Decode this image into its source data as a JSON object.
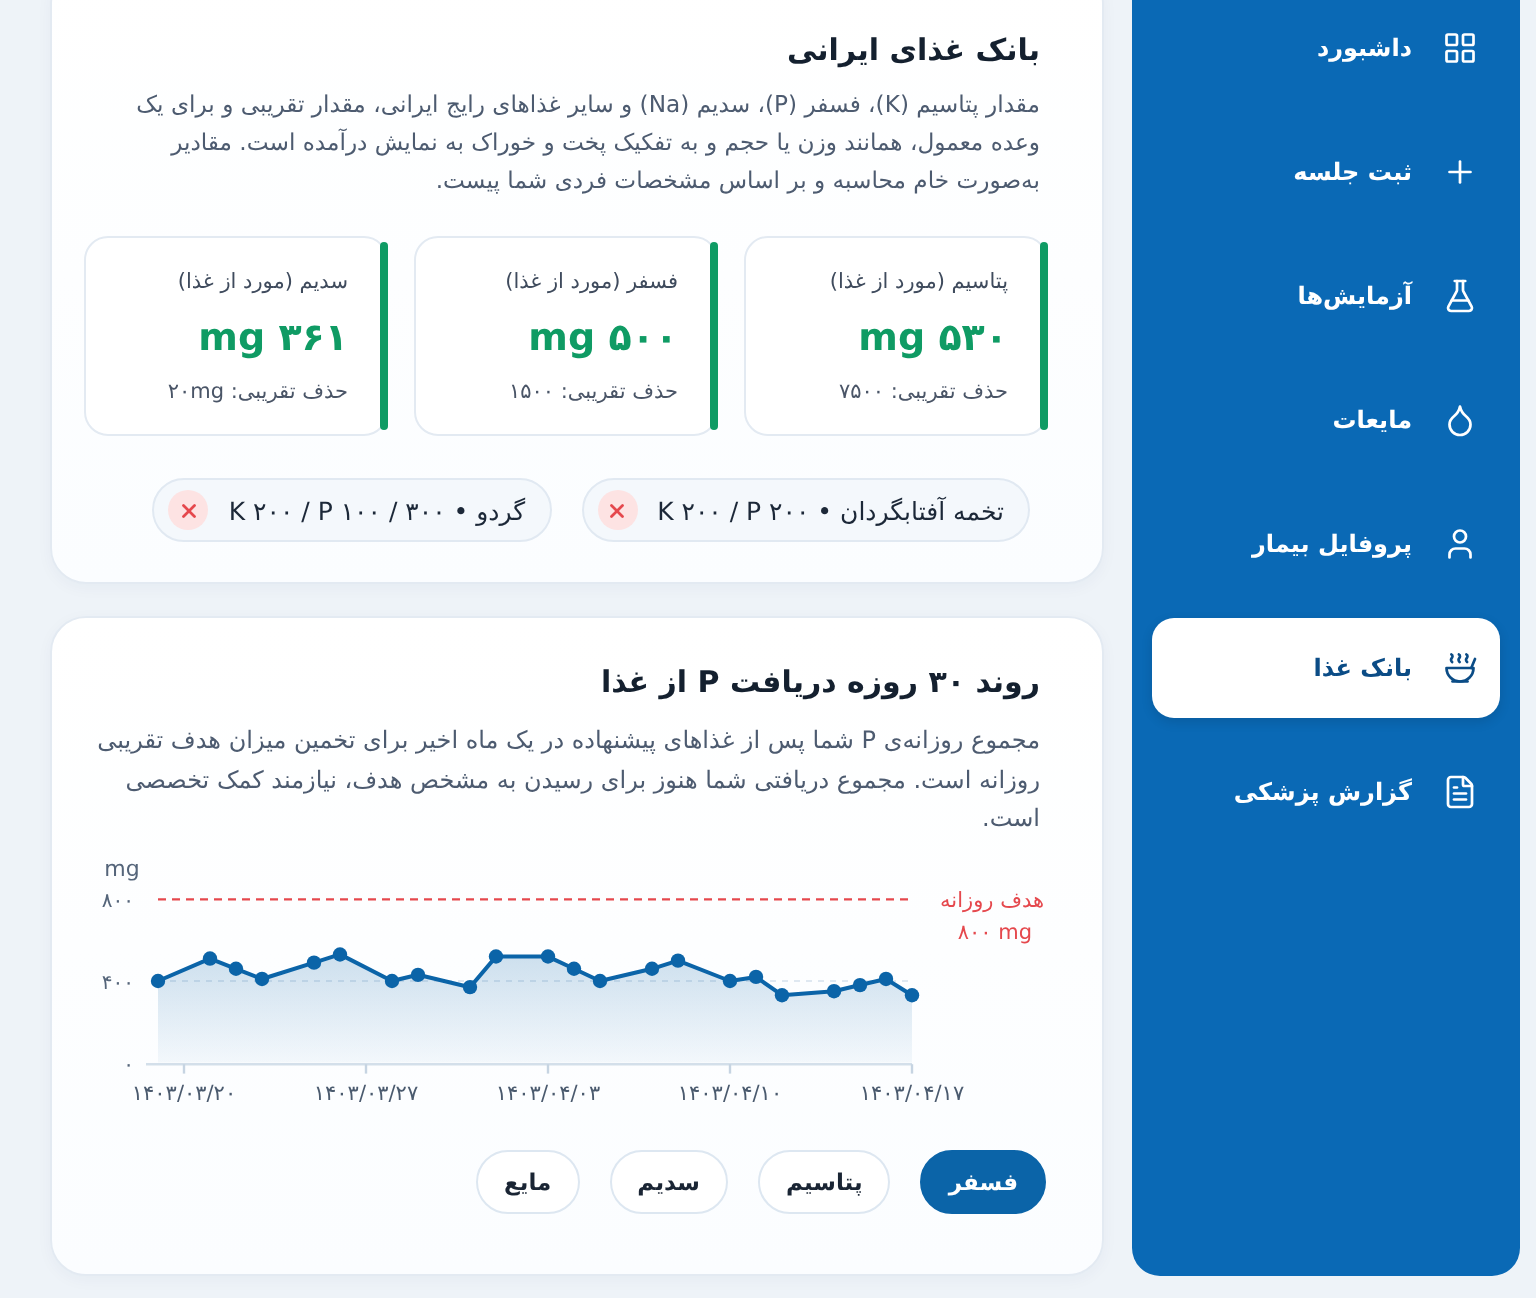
{
  "sidebar": {
    "items": [
      {
        "label": "داشبورد",
        "selected": false
      },
      {
        "label": "ثبت جلسه",
        "selected": false
      },
      {
        "label": "آزمایش‌ها",
        "selected": false
      },
      {
        "label": "مایعات",
        "selected": false
      },
      {
        "label": "پروفایل بیمار",
        "selected": false
      },
      {
        "label": "بانک غذا",
        "selected": true
      },
      {
        "label": "گزارش پزشکی",
        "selected": false
      }
    ]
  },
  "food_bank": {
    "title": "بانک غذای ایرانی",
    "description": "مقدار پتاسیم (K)، فسفر (P)، سدیم (Na) و سایر غذاهای رایج ایرانی، مقدار تقریبی و برای یک وعده معمول، همانند وزن یا حجم و به تفکیک پخت و خوراک به نمایش درآمده است. مقادیر به‌صورت خام محاسبه و بر اساس مشخصات فردی شما پیست.",
    "metrics": [
      {
        "label": "پتاسیم (مورد از غذا)",
        "value": "۵۳۰ mg",
        "note": "حذف تقریبی: ۷۵۰۰"
      },
      {
        "label": "فسفر (مورد از غذا)",
        "value": "۵۰۰ mg",
        "note": "حذف تقریبی: ۱۵۰۰"
      },
      {
        "label": "سدیم (مورد از غذا)",
        "value": "۳۶۱ mg",
        "note": "حذف تقریبی: ۲۰mg"
      }
    ],
    "selected_foods": [
      {
        "label": "تخمه آفتابگردان • K ۲۰۰ / P ۲۰۰"
      },
      {
        "label": "گردو • ۳۰۰ / K ۲۰۰ / P ۱۰۰"
      }
    ]
  },
  "intake_trend": {
    "title": "روند ۳۰ روزه دریافت P از غذا",
    "description": "مجموع روزانه‌ی P شما پس از غذاهای پیشنهاده در یک ماه اخیر برای تخمین میزان هدف تقریبی روزانه است. مجموع دریافتی شما هنوز برای رسیدن به مشخص هدف، نیازمند کمک تخصصی است.",
    "chart_data": {
      "type": "area",
      "ylabel": "mg",
      "categories": [
        null,
        "۱۴۰۳/۰۳/۲۰",
        null,
        null,
        null,
        null,
        null,
        null,
        "۱۴۰۳/۰۳/۲۷",
        null,
        null,
        null,
        null,
        null,
        null,
        "۱۴۰۳/۰۴/۰۳",
        null,
        null,
        null,
        null,
        null,
        null,
        "۱۴۰۳/۰۴/۱۰",
        null,
        null,
        null,
        null,
        null,
        null,
        "۱۴۰۳/۰۴/۱۷"
      ],
      "series": [
        {
          "color": "#0b64a8",
          "values": [
            400,
            null,
            510,
            460,
            410,
            null,
            490,
            530,
            null,
            400,
            430,
            null,
            370,
            520,
            null,
            520,
            460,
            400,
            null,
            460,
            500,
            null,
            400,
            420,
            330,
            null,
            350,
            380,
            410,
            330
          ]
        }
      ],
      "ylim": [
        0,
        800
      ],
      "yticks": [
        {
          "value": 0,
          "label": "۰"
        },
        {
          "value": 400,
          "label": "۴۰۰"
        },
        {
          "value": 800,
          "label": "۸۰۰"
        }
      ]
    },
    "daily_goal": {
      "label": "هدف روزانه",
      "amount": "۸۰۰ mg"
    },
    "nutrient_buttons": [
      {
        "label": "فسفر",
        "selected": true
      },
      {
        "label": "پتاسیم",
        "selected": false
      },
      {
        "label": "سدیم",
        "selected": false
      },
      {
        "label": "مایع",
        "selected": false
      }
    ]
  }
}
